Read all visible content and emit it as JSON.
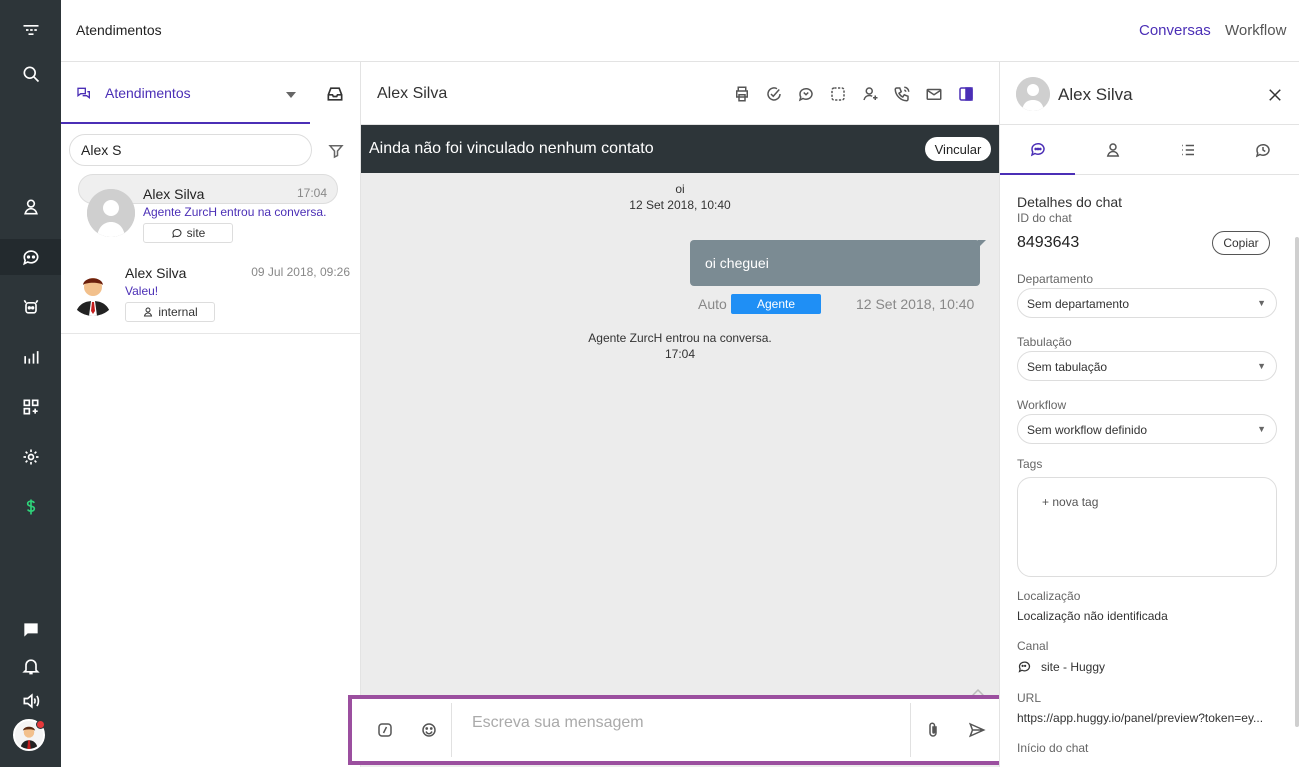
{
  "app": {
    "section_title": "Atendimentos",
    "nav_links": [
      "Conversas",
      "Workflow"
    ]
  },
  "rail": {
    "icons": [
      "logo-icon",
      "search-icon",
      "contacts-icon",
      "chat-icon",
      "bot-icon",
      "reports-icon",
      "apps-icon",
      "settings-icon",
      "billing-icon",
      "message-icon",
      "notification-icon",
      "sound-icon"
    ]
  },
  "list": {
    "tab_label": "Atendimentos",
    "search_value": "Alex S",
    "conversations": [
      {
        "name": "Alex Silva",
        "time": "17:04",
        "last_message": "Agente ZurcH entrou na conversa.",
        "channel": "site"
      },
      {
        "name": "Alex Silva",
        "time": "09 Jul 2018, 09:26",
        "last_message": "Valeu!",
        "channel": "internal"
      }
    ]
  },
  "chat": {
    "contact_name": "Alex Silva",
    "banner_text": "Ainda não foi vinculado nenhum contato",
    "link_button": "Vincular",
    "messages": {
      "first_text": "oi",
      "first_time": "12 Set 2018, 10:40",
      "bubble_text": "oi cheguei",
      "bubble_mode": "Auto",
      "bubble_badge": "Agente",
      "bubble_time": "12 Set 2018, 10:40",
      "system_text": "Agente ZurcH entrou na conversa.",
      "system_time": "17:04"
    },
    "composer_placeholder": "Escreva sua mensagem"
  },
  "details": {
    "contact_name": "Alex Silva",
    "section_title": "Detalhes do chat",
    "id_label": "ID do chat",
    "id_value": "8493643",
    "copy_label": "Copiar",
    "departamento_label": "Departamento",
    "departamento_value": "Sem departamento",
    "tabulacao_label": "Tabulação",
    "tabulacao_value": "Sem tabulação",
    "workflow_label": "Workflow",
    "workflow_value": "Sem workflow definido",
    "tags_label": "Tags",
    "new_tag": "+ nova tag",
    "localizacao_label": "Localização",
    "localizacao_value": "Localização não identificada",
    "canal_label": "Canal",
    "canal_value": "site - Huggy",
    "url_label": "URL",
    "url_value": "https://app.huggy.io/panel/preview?token=ey...",
    "inicio_label": "Início do chat"
  },
  "colors": {
    "accent": "#4b2fb6",
    "rail": "#2d3539",
    "badge": "#1f8ff5",
    "composer_border": "#9b4f9f",
    "billing": "#2ed37a"
  }
}
